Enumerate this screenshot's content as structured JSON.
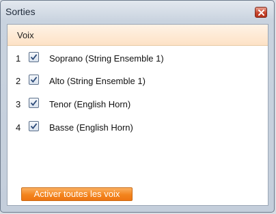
{
  "window": {
    "title": "Sorties"
  },
  "list": {
    "column_header": "Voix",
    "rows": [
      {
        "number": "1",
        "label": "Soprano (String Ensemble 1)",
        "checked": true
      },
      {
        "number": "2",
        "label": "Alto (String Ensemble 1)",
        "checked": true
      },
      {
        "number": "3",
        "label": "Tenor (English Horn)",
        "checked": true
      },
      {
        "number": "4",
        "label": "Basse (English Horn)",
        "checked": true
      }
    ]
  },
  "footer": {
    "activate_all_label": "Activer toutes les voix"
  },
  "colors": {
    "accent_orange": "#f3841d",
    "header_tint": "#fde2c6",
    "close_red": "#c8452d"
  },
  "icons": {
    "close": "close-icon",
    "check": "checkmark-icon"
  }
}
